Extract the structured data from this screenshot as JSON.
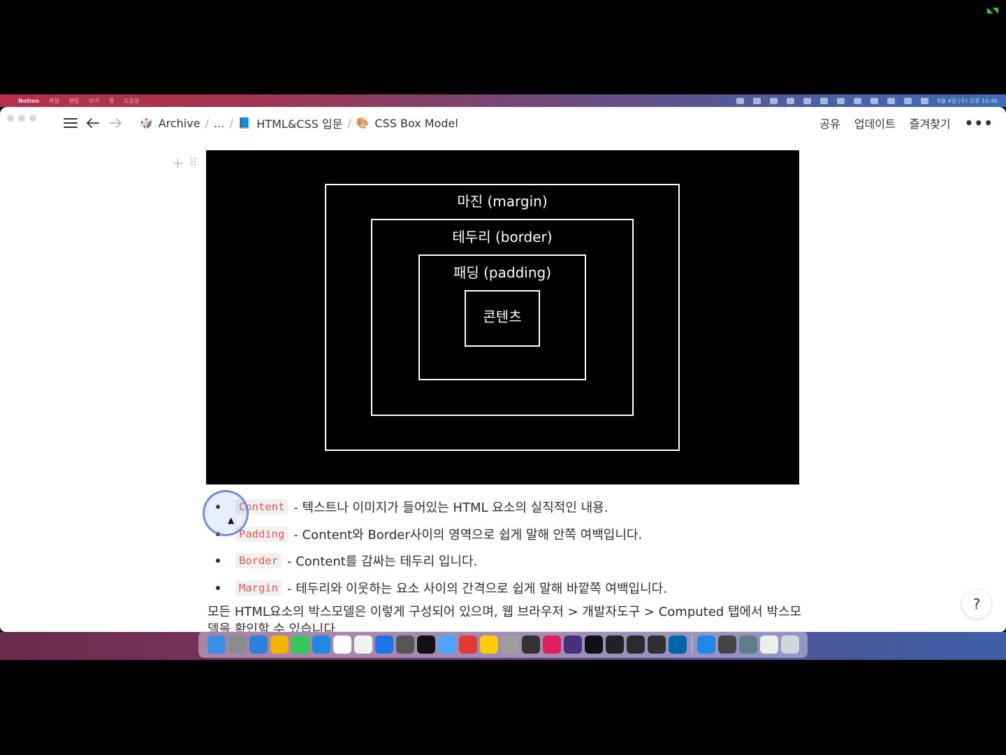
{
  "menubar": {
    "app_name": "Notion",
    "menus": [
      "파일",
      "편집",
      "보기",
      "창",
      "도움말"
    ],
    "clock": "8월 4일 (수) 오후 10:46"
  },
  "topbar": {
    "breadcrumbs": [
      {
        "emoji": "🎲",
        "label": "Archive"
      },
      {
        "emoji": "",
        "label": "..."
      },
      {
        "emoji": "📘",
        "label": "HTML&CSS 입문"
      },
      {
        "emoji": "🎨",
        "label": "CSS Box Model"
      }
    ],
    "separator": "/",
    "share_label": "공유",
    "updates_label": "업데이트",
    "favorite_label": "즐겨찾기",
    "more_label": "•••"
  },
  "diagram": {
    "margin_label": "마진 (margin)",
    "border_label": "테두리 (border)",
    "padding_label": "패딩 (padding)",
    "content_label": "콘텐츠"
  },
  "bullets": [
    {
      "code": "Content",
      "text": "- 텍스트나 이미지가 들어있는 HTML 요소의 실직적인 내용."
    },
    {
      "code": "Padding",
      "text": "- Content와 Border사이의 영역으로 쉽게 말해 안쪽 여백입니다."
    },
    {
      "code": "Border",
      "text": "- Content를 감싸는 테두리 입니다."
    },
    {
      "code": "Margin",
      "text": "- 테두리와 이웃하는 요소 사이의 간격으로 쉽게 말해 바깥쪽 여백입니다."
    }
  ],
  "paragraph": "모든 HTML요소의 박스모델은 이렇게 구성되어 있으며, 웹 브라우저 > 개발자도구 > Computed 탭에서 박스모델을 확인할 수 있습니다.",
  "help_label": "?",
  "dock": {
    "colors": [
      "#3a8ee6",
      "#8c8c8c",
      "#2d7fe0",
      "#f4b400",
      "#34c759",
      "#1e88e5",
      "#ffffff",
      "#f2f2f2",
      "#1a73e8",
      "#555555",
      "#111111",
      "#4da3ff",
      "#e53935",
      "#ffcc00",
      "#9e9e9e",
      "#333333",
      "#e01e5a",
      "#4a2f7a",
      "#101010",
      "#222222",
      "#2b2b2b",
      "#303030",
      "#0065a9",
      "#1e88e5",
      "#444444",
      "#607d8b",
      "#eeeeee",
      "#cfd8dc"
    ]
  }
}
